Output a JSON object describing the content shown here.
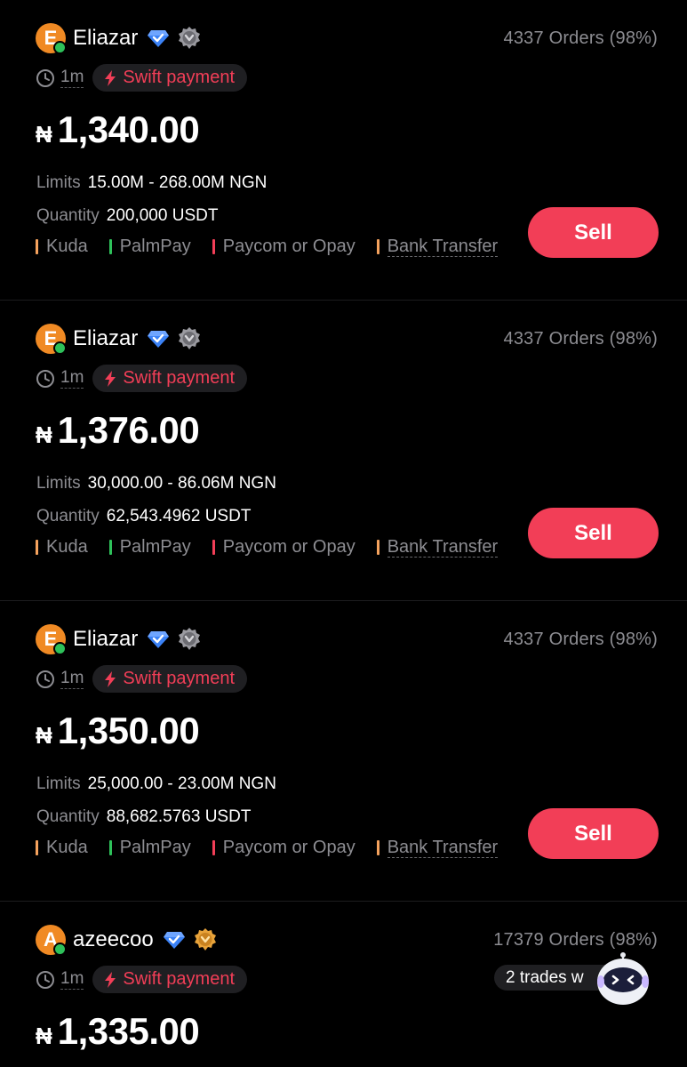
{
  "listings": [
    {
      "avatar_letter": "E",
      "name": "Eliazar",
      "orders": "4337 Orders (98%)",
      "time": "1m",
      "swift_label": "Swift payment",
      "currency_symbol": "₦",
      "price": "1,340.00",
      "limits_label": "Limits",
      "limits": "15.00M - 268.00M NGN",
      "quantity_label": "Quantity",
      "quantity": "200,000 USDT",
      "payments": [
        "Kuda",
        "PalmPay",
        "Paycom or Opay",
        "Bank Transfer"
      ],
      "action": "Sell",
      "medal": "silver"
    },
    {
      "avatar_letter": "E",
      "name": "Eliazar",
      "orders": "4337 Orders (98%)",
      "time": "1m",
      "swift_label": "Swift payment",
      "currency_symbol": "₦",
      "price": "1,376.00",
      "limits_label": "Limits",
      "limits": "30,000.00 - 86.06M NGN",
      "quantity_label": "Quantity",
      "quantity": "62,543.4962 USDT",
      "payments": [
        "Kuda",
        "PalmPay",
        "Paycom or Opay",
        "Bank Transfer"
      ],
      "action": "Sell",
      "medal": "silver"
    },
    {
      "avatar_letter": "E",
      "name": "Eliazar",
      "orders": "4337 Orders (98%)",
      "time": "1m",
      "swift_label": "Swift payment",
      "currency_symbol": "₦",
      "price": "1,350.00",
      "limits_label": "Limits",
      "limits": "25,000.00 - 23.00M NGN",
      "quantity_label": "Quantity",
      "quantity": "88,682.5763 USDT",
      "payments": [
        "Kuda",
        "PalmPay",
        "Paycom or Opay",
        "Bank Transfer"
      ],
      "action": "Sell",
      "medal": "silver"
    },
    {
      "avatar_letter": "A",
      "name": "azeecoo",
      "orders": "17379 Orders (98%)",
      "time": "1m",
      "swift_label": "Swift payment",
      "currency_symbol": "₦",
      "price": "1,335.00",
      "trades_pill": "2 trades w",
      "medal": "gold"
    }
  ],
  "payment_colors": {
    "Kuda": "#f5a25d",
    "PalmPay": "#2ec15a",
    "Paycom or Opay": "#f23e57",
    "Bank Transfer": "#f5a25d"
  },
  "colors": {
    "background": "#000000",
    "accent_red": "#f23e57",
    "muted_text": "#8d8d92",
    "avatar_orange": "#f08a24",
    "verified_blue": "#3b82f6"
  },
  "icons": {
    "verified": "verified-diamond-icon",
    "medal": "medal-badge-icon",
    "clock": "clock-icon",
    "swift": "lightning-bolt-icon",
    "assistant": "robot-assistant-icon"
  }
}
